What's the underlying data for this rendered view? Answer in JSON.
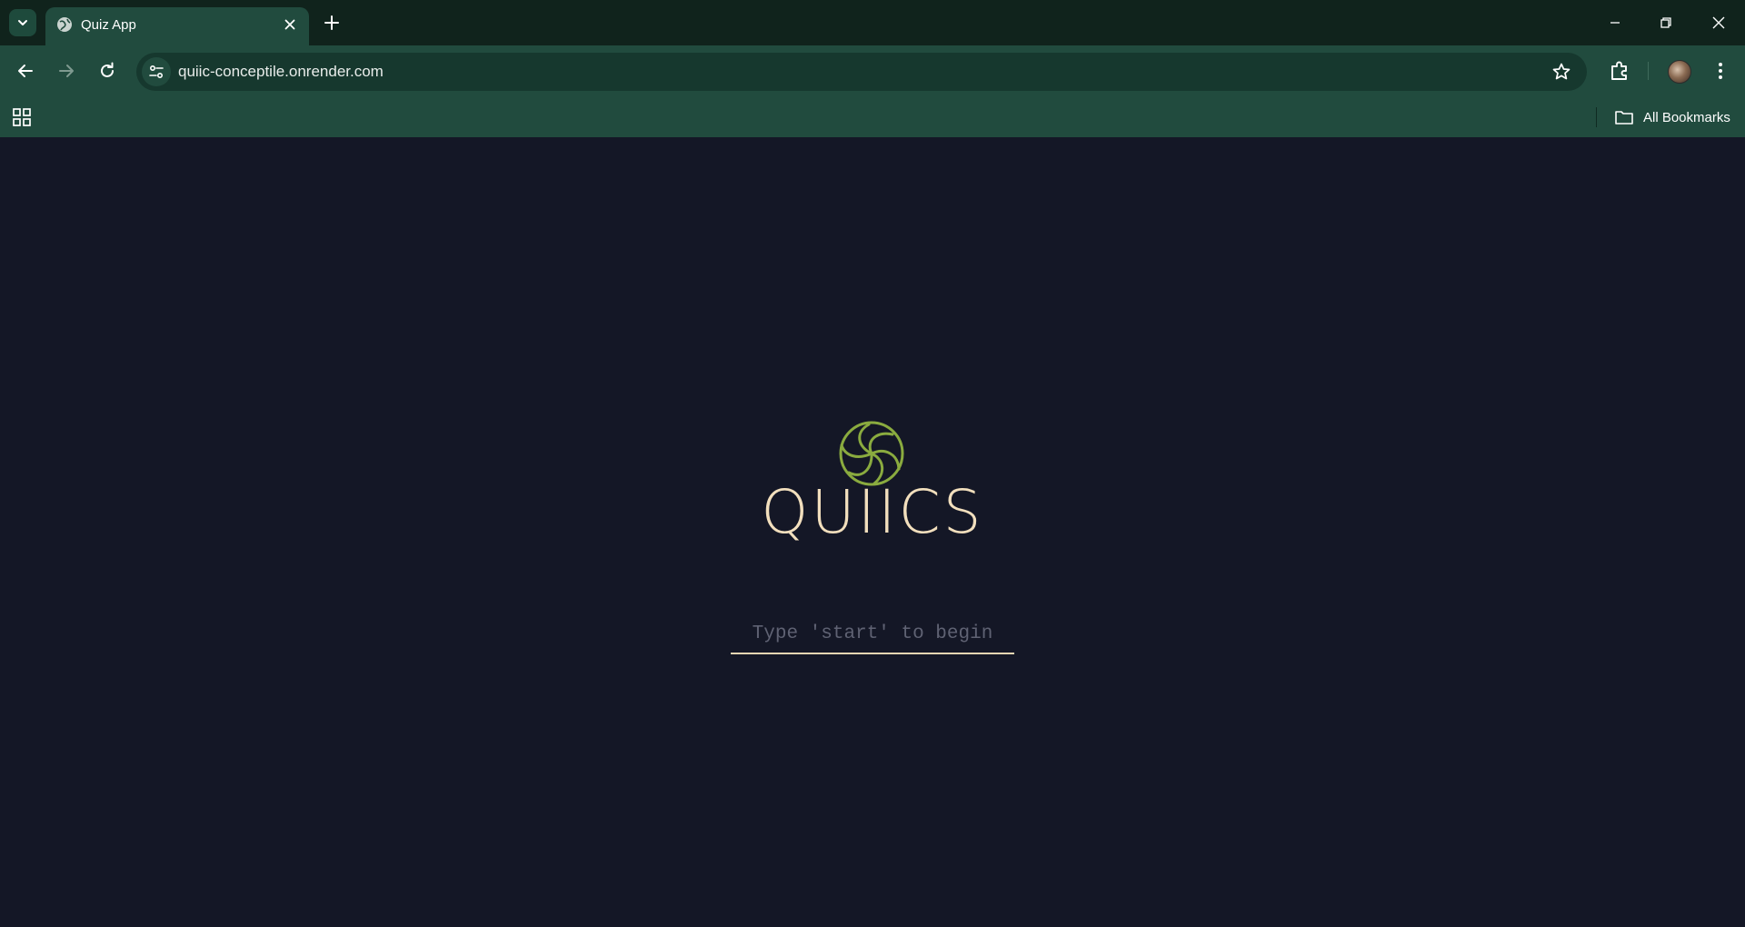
{
  "browser": {
    "tab": {
      "title": "Quiz App"
    },
    "address_bar": {
      "url": "quiic-conceptile.onrender.com"
    },
    "bookmarks_bar": {
      "all_bookmarks_label": "All Bookmarks"
    }
  },
  "page": {
    "brand": {
      "name": "QUIICS"
    },
    "command_input": {
      "value": "",
      "placeholder": "Type 'start' to begin"
    }
  },
  "colors": {
    "page_background": "#141726",
    "browser_frame": "#214b3e",
    "logo_green": "#8aab3f",
    "brand_cream": "#f2dfbd"
  },
  "icons": {
    "logo": "swirl-circle-icon",
    "tab_favicon": "globe-icon"
  }
}
